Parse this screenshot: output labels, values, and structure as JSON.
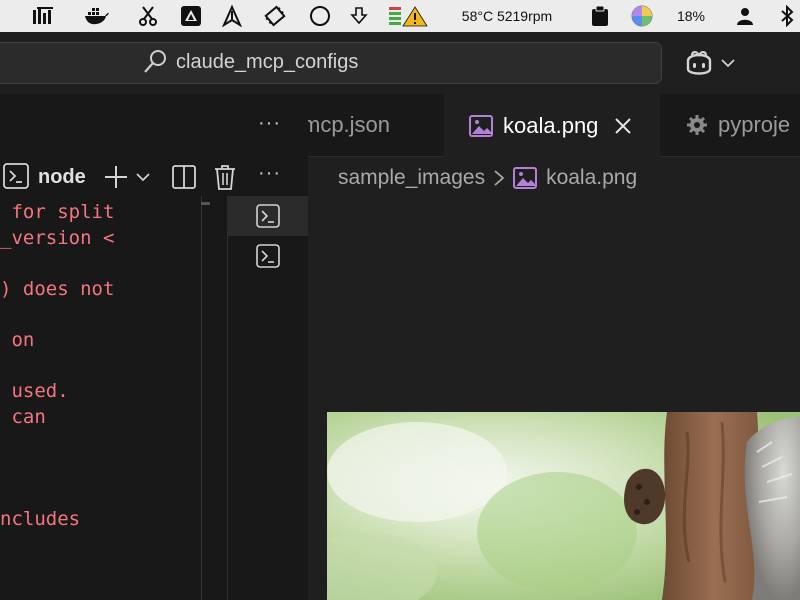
{
  "menubar": {
    "icons": [
      "stats-icon",
      "docker-icon",
      "scissors-icon",
      "drive-icon",
      "vpn-icon",
      "film-icon",
      "circle-icon",
      "download-arrow-icon",
      "memory-warning-icon",
      "clipboard-icon",
      "color-wheel-icon",
      "user-icon",
      "bluetooth-icon"
    ],
    "temp_fan": "58°C 5219rpm",
    "battery_percent": "18%"
  },
  "titlebar": {
    "search_text": "claude_mcp_configs",
    "icons": [
      "search-icon",
      "copilot-icon",
      "chevron-down-icon"
    ]
  },
  "terminal": {
    "more_label": "···",
    "tab_name": "node",
    "icons": [
      "terminal-icon",
      "plus-icon",
      "chevron-down-icon",
      "split-icon",
      "trash-icon",
      "more-icon"
    ],
    "lines": [
      " for split",
      "_version <",
      ") does not",
      " on",
      " used.",
      " can",
      "ncludes"
    ],
    "accent_color": "#f47580"
  },
  "editor": {
    "tabs": [
      {
        "label": "mcp.json",
        "active": false
      },
      {
        "label": "koala.png",
        "active": true
      },
      {
        "label": "pyproje",
        "active": false
      }
    ],
    "breadcrumb": {
      "folder": "sample_images",
      "separator": ">",
      "file": "koala.png"
    },
    "image_subject": "koala photo"
  },
  "colors": {
    "background": "#1e1e1e",
    "tab_active": "#1f1f1f",
    "image_icon_purple": "#b180d7"
  }
}
